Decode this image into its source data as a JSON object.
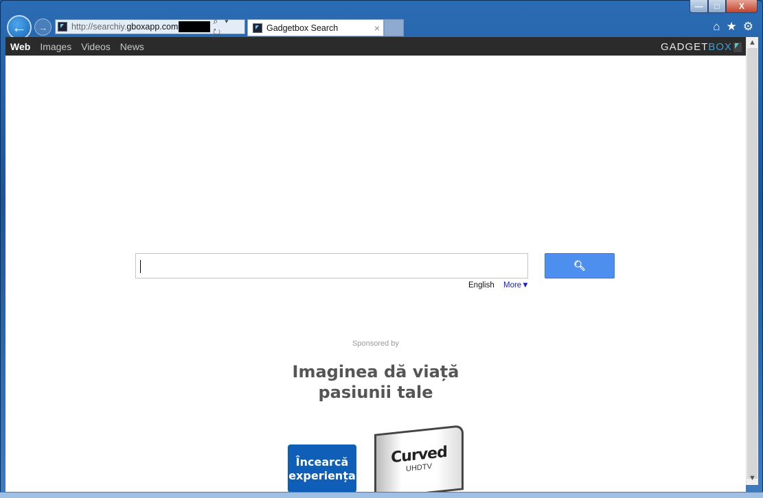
{
  "browser": {
    "url_prefix": "http://searchiy.",
    "url_domain": "gboxapp.com",
    "tab_title": "Gadgetbox Search",
    "tab_close": "×",
    "window_buttons": {
      "minimize": "—",
      "maximize": "□",
      "close": "X"
    },
    "addr_icons": "⌕ ▾ ↻",
    "tools": {
      "home": "⌂",
      "favorites": "★",
      "settings": "⚙"
    }
  },
  "nav": {
    "items": [
      {
        "label": "Web",
        "active": true
      },
      {
        "label": "Images"
      },
      {
        "label": "Videos"
      },
      {
        "label": "News"
      }
    ],
    "logo_a": "GADGET",
    "logo_b": "BOX"
  },
  "search": {
    "value": "",
    "button_icon": "🔍︎",
    "language": "English",
    "more": "More▼"
  },
  "ad": {
    "sponsored": "Sponsored by",
    "headline_1": "Imaginea dă viață",
    "headline_2": "pasiunii tale",
    "cta_1": "Încearcă",
    "cta_2": "experiența",
    "product": "Curved",
    "product_sub": "UHDTV"
  },
  "colors": {
    "accent": "#4d8fef",
    "navbar": "#2b2b2b",
    "cta": "#0f5fb8"
  }
}
